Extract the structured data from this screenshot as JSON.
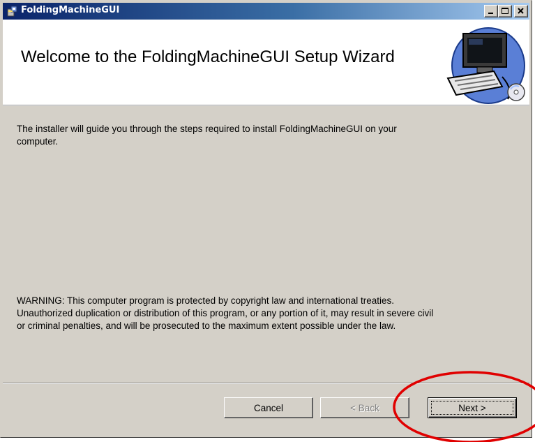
{
  "window": {
    "title": "FoldingMachineGUI"
  },
  "title_controls": {
    "minimize_icon": "minimize-icon",
    "maximize_icon": "maximize-icon",
    "close_icon": "close-icon"
  },
  "banner": {
    "heading": "Welcome to the FoldingMachineGUI Setup Wizard",
    "art_icon": "computer-setup-icon"
  },
  "content": {
    "intro_line1": "The installer will guide you through the steps required to install FoldingMachineGUI on your",
    "intro_line2": "computer.",
    "warning_line1": "WARNING: This computer program is protected by copyright law and international treaties.",
    "warning_line2": "Unauthorized duplication or distribution of this program, or any portion of it, may result in severe civil",
    "warning_line3": "or criminal penalties, and will be prosecuted to the maximum extent possible under the law."
  },
  "buttons": {
    "cancel": {
      "label": "Cancel",
      "enabled": true
    },
    "back": {
      "label": "< Back",
      "enabled": false
    },
    "next": {
      "label": "Next >",
      "enabled": true,
      "default": true
    }
  },
  "annotation": {
    "shape": "ellipse",
    "color": "#e00000",
    "target": "next-button"
  }
}
